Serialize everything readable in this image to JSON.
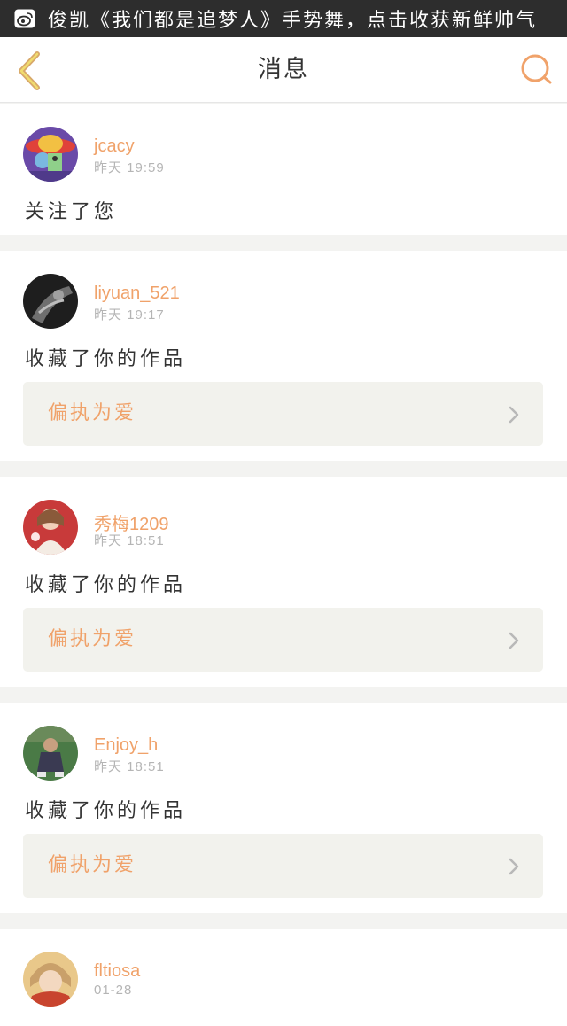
{
  "banner": {
    "text": "俊凯《我们都是追梦人》手势舞，点击收获新鲜帅气"
  },
  "header": {
    "title": "消息"
  },
  "messages": [
    {
      "username": "jcacy",
      "time": "昨天  19:59",
      "action": "关注了您"
    },
    {
      "username": "liyuan_521",
      "time": "昨天  19:17",
      "action": "收藏了你的作品",
      "work": "偏执为爱"
    },
    {
      "username": "秀梅1209",
      "time": "昨天  18:51",
      "action": "收藏了你的作品",
      "work": "偏执为爱"
    },
    {
      "username": "Enjoy_h",
      "time": "昨天  18:51",
      "action": "收藏了你的作品",
      "work": "偏执为爱"
    },
    {
      "username": "fltiosa",
      "time": "01-28"
    }
  ],
  "colors": {
    "accent": "#f0a26a",
    "banner_bg": "#2d2d2d",
    "card_bg": "#ffffff",
    "gap_bg": "#f3f3f1",
    "work_bg": "#f2f2ed"
  },
  "icons": [
    "weibo-icon",
    "back-arrow-icon",
    "search-icon",
    "chevron-right-icon"
  ]
}
